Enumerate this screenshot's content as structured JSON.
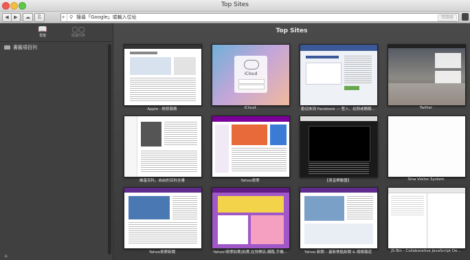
{
  "window": {
    "title": "Top Sites"
  },
  "toolbar": {
    "back": "◀",
    "forward": "▶",
    "cloud": "☁",
    "share": "⎘",
    "address_placeholder": "搜尋「Google」或輸入位址",
    "reader": "閱讀器"
  },
  "sidebar": {
    "tabs": [
      {
        "label": "書籤",
        "icon": "book-icon"
      },
      {
        "label": "閱讀列表",
        "icon": "glasses-icon"
      }
    ],
    "items": [
      {
        "label": "書籤項目列"
      }
    ],
    "add": "+"
  },
  "main": {
    "title": "Top Sites",
    "tiles": [
      {
        "caption": "Apple - 檢修服務"
      },
      {
        "caption": "iCloud",
        "thumb_text": "iCloud"
      },
      {
        "caption": "歡迎來到 Facebook — 登入、註冊或瞭解..."
      },
      {
        "caption": "Twitter"
      },
      {
        "caption": "維基百科，自由的百科全書"
      },
      {
        "caption": "Yahoo奇摩"
      },
      {
        "caption": "【吳音樂聯盟】"
      },
      {
        "caption": "Sina Visitor System"
      },
      {
        "caption": "Yahoo奇摩新聞"
      },
      {
        "caption": "Yahoo!奇摩拍賣|拍賣,在快樂店,網路,手機..."
      },
      {
        "caption": "Yahoo 新聞 – 最新焦點新聞 & 頭條報道"
      },
      {
        "caption": "JS Bin - Collaborative JavaScript De..."
      }
    ]
  },
  "colors": {
    "accent_blue": "#3b5998",
    "sidebar_bg": "#404040",
    "main_bg": "#444444"
  }
}
